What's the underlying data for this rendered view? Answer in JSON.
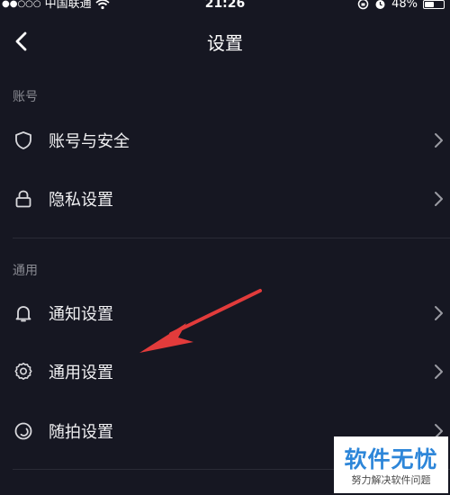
{
  "status_bar": {
    "signal": "●●○○○",
    "carrier": "中国联通",
    "time": "21:26",
    "battery": "48%",
    "battery_level": 0.48
  },
  "nav": {
    "title": "设置",
    "back_icon": "chevron-left-icon"
  },
  "sections": {
    "account": {
      "title": "账号",
      "items": [
        {
          "label": "账号与安全",
          "icon": "shield-icon"
        },
        {
          "label": "隐私设置",
          "icon": "lock-icon"
        }
      ]
    },
    "general": {
      "title": "通用",
      "items": [
        {
          "label": "通知设置",
          "icon": "bell-icon"
        },
        {
          "label": "通用设置",
          "icon": "gear-icon"
        },
        {
          "label": "随拍设置",
          "icon": "circle-capture-icon"
        }
      ]
    }
  },
  "watermark": {
    "title": "软件无忧",
    "subtitle": "努力解决软件问题"
  },
  "colors": {
    "background": "#161722",
    "section_title": "#8a8b93",
    "annotation_arrow": "#e23b3b",
    "watermark_blue": "#2d86d9"
  }
}
